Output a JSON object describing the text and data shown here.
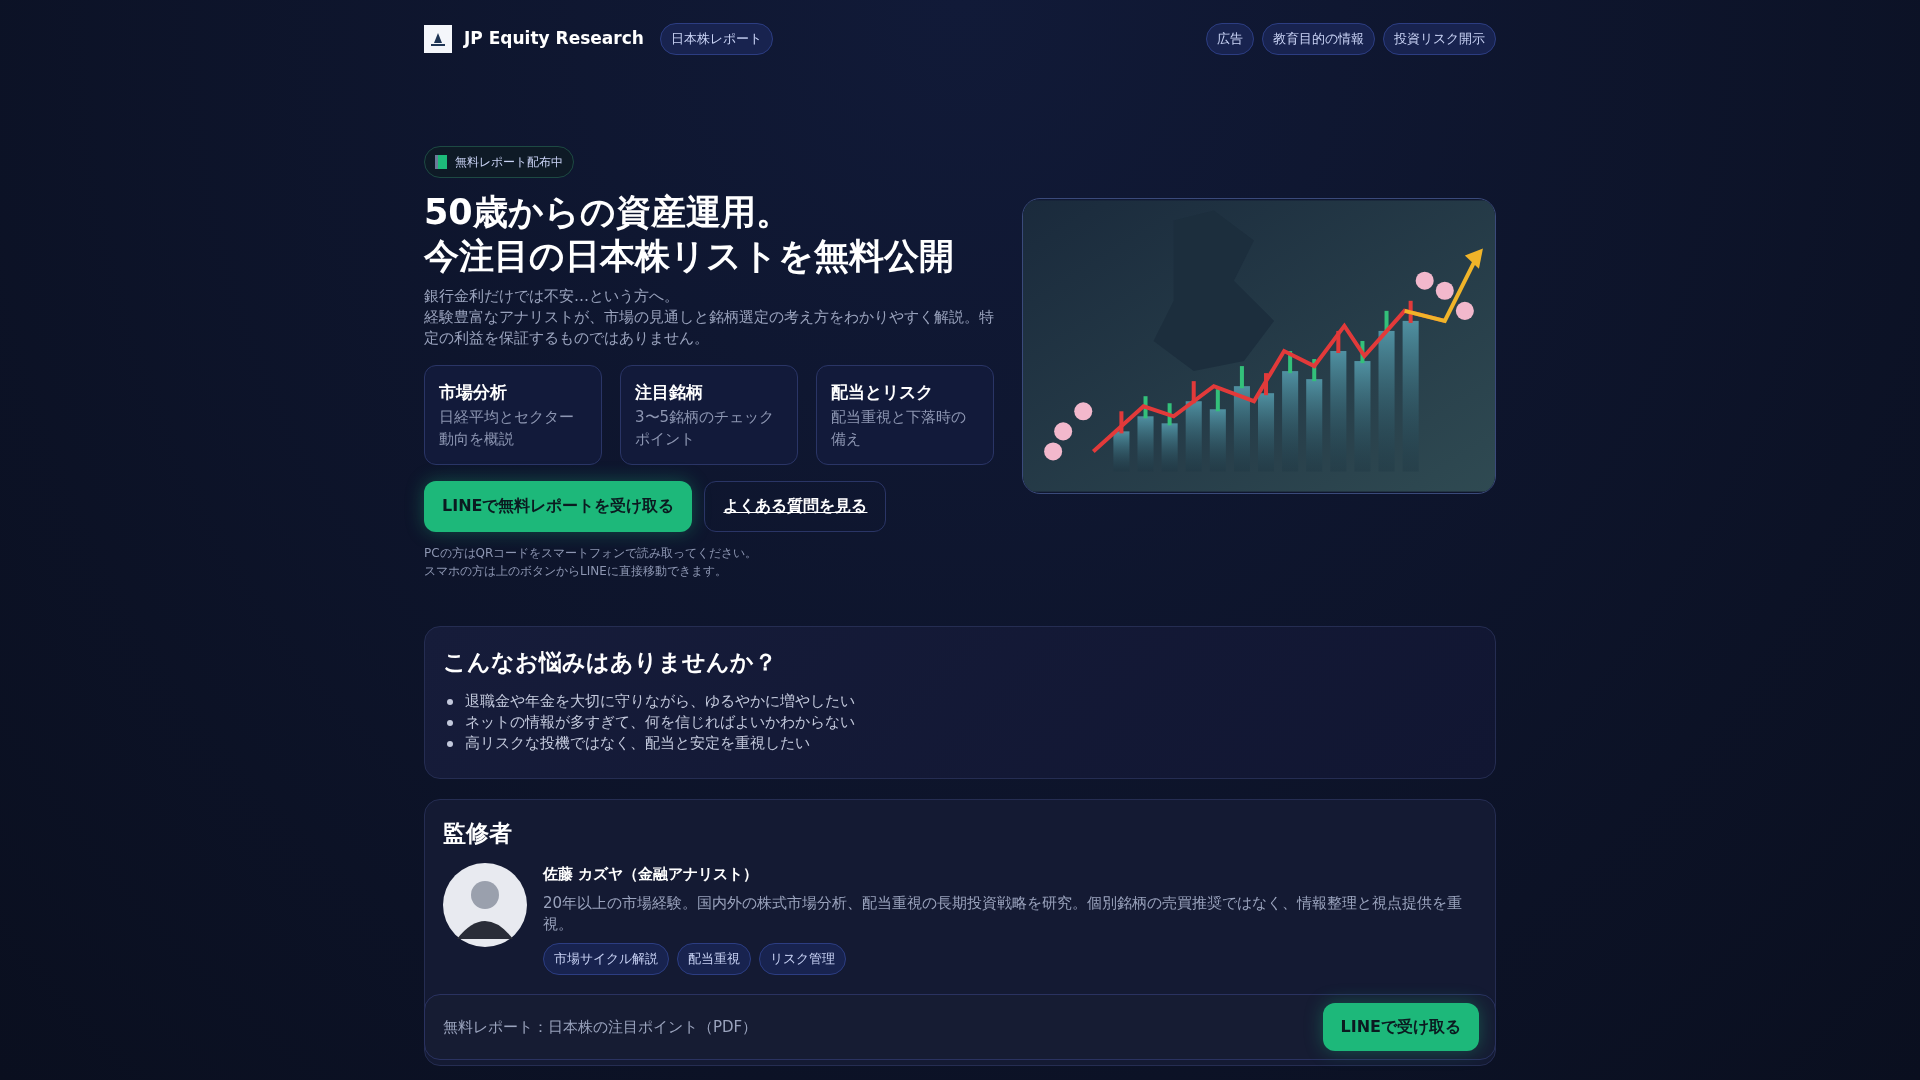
{
  "header": {
    "brand": "JP Equity Research",
    "tag": "日本株レポート",
    "nav": [
      "広告",
      "教育目的の情報",
      "投資リスク開示"
    ]
  },
  "hero": {
    "badge": "無料レポート配布中",
    "headline": [
      "50歳からの資産運用。",
      "今注目の日本株リストを無料公開"
    ],
    "lead": [
      "銀行金利だけでは不安…という方へ。",
      "経験豊富なアナリストが、市場の見通しと銘柄選定の考え方をわかりやすく解説。特定の利益を保証するものではありません。"
    ],
    "features": [
      {
        "title": "市場分析",
        "text": "日経平均とセクター動向を概説"
      },
      {
        "title": "注目銘柄",
        "text": "3〜5銘柄のチェックポイント"
      },
      {
        "title": "配当とリスク",
        "text": "配当重視と下落時の備え"
      }
    ],
    "primary_button": "LINEで無料レポートを受け取る",
    "secondary_button": "よくある質問を見る",
    "notes": [
      "PCの方はQRコードをスマートフォンで読み取ってください。",
      "スマホの方は上のボタンからLINEに直接移動できます。"
    ]
  },
  "worries": {
    "title": "こんなお悩みはありませんか？",
    "items": [
      "退職金や年金を大切に守りながら、ゆるやかに増やしたい",
      "ネットの情報が多すぎて、何を信じればよいかわからない",
      "高リスクな投機ではなく、配当と安定を重視したい"
    ]
  },
  "supervisor": {
    "title": "監修者",
    "name": "佐藤 カズヤ（金融アナリスト）",
    "bio": "20年以上の市場経験。国内外の株式市場分析、配当重視の長期投資戦略を研究。個別銘柄の売買推奨ではなく、情報整理と視点提供を重視。",
    "tags": [
      "市場サイクル解説",
      "配当重視",
      "リスク管理"
    ]
  },
  "sticky_bar": {
    "text": "無料レポート：日本株の注目ポイント（PDF）",
    "button": "LINEで受け取る"
  }
}
